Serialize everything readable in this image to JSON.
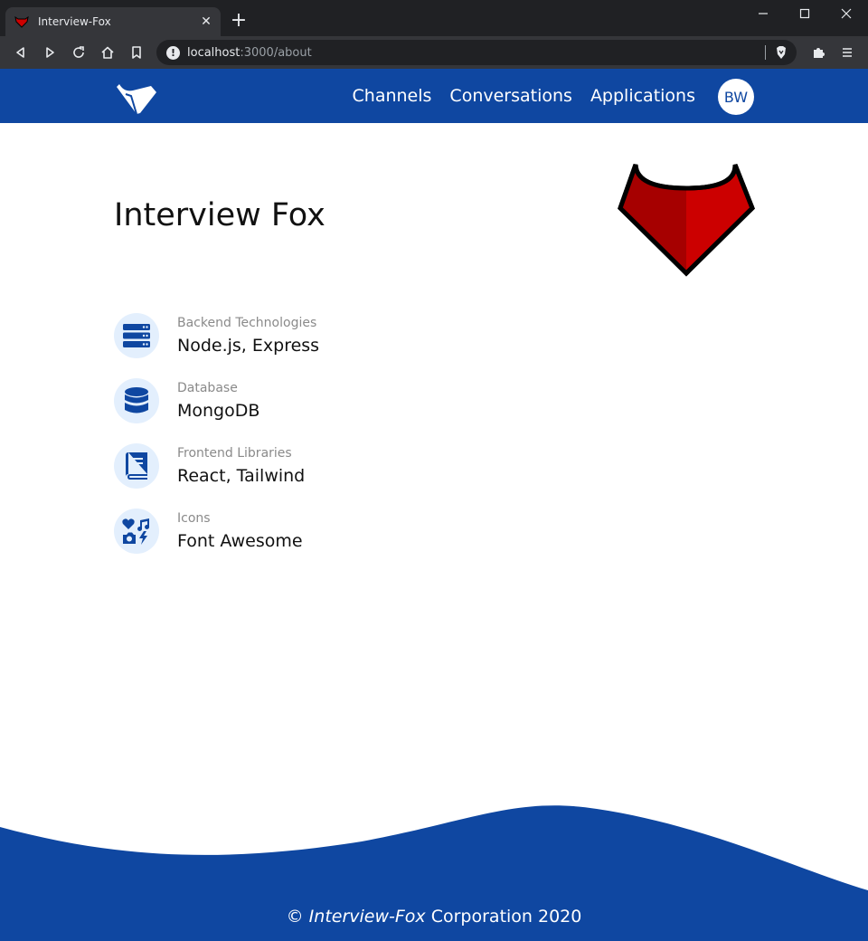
{
  "browser": {
    "tab_title": "Interview-Fox",
    "url_host": "localhost",
    "url_path": ":3000/about"
  },
  "nav": {
    "links": [
      {
        "label": "Channels"
      },
      {
        "label": "Conversations"
      },
      {
        "label": "Applications"
      }
    ],
    "avatar_initials": "BW"
  },
  "page": {
    "title": "Interview Fox"
  },
  "tech": [
    {
      "label": "Backend Technologies",
      "value": "Node.js, Express",
      "icon": "server-icon"
    },
    {
      "label": "Database",
      "value": "MongoDB",
      "icon": "database-icon"
    },
    {
      "label": "Frontend Libraries",
      "value": "React, Tailwind",
      "icon": "book-icon"
    },
    {
      "label": "Icons",
      "value": "Font Awesome",
      "icon": "icons-icon"
    }
  ],
  "footer": {
    "prefix": "© ",
    "brand": "Interview-Fox",
    "suffix": " Corporation 2020"
  },
  "colors": {
    "brand_blue": "#0f47a1",
    "fox_red": "#cc0000",
    "icon_bg": "#e3effd"
  }
}
